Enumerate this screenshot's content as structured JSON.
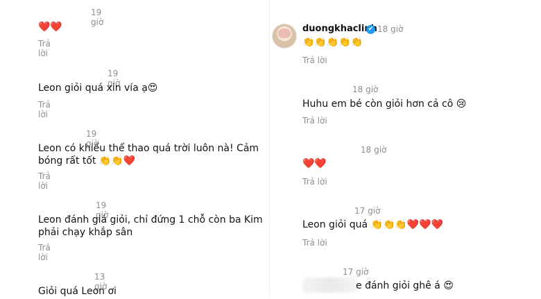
{
  "left_comments": [
    {
      "time": "19 giờ",
      "text": "❤️❤️",
      "reply": "Trả lời"
    },
    {
      "time": "19 giờ",
      "text": "Leon giỏi quá xin vía ạ😍",
      "reply": "Trả lời"
    },
    {
      "time": "19 giờ",
      "text_line1": "Leon có khiếu thể thao quá trời luôn nà! Cảm",
      "text_line2": "bóng rất tốt 👏👏❤️",
      "reply": "Trả lời"
    },
    {
      "time": "19 giờ",
      "text_line1": "Leon đánh giá giỏi, chỉ đứng 1 chỗ còn ba Kim",
      "text_line2": "phải chạy khắp sân",
      "reply": "Trả lời"
    },
    {
      "time": "13 giờ",
      "text": "Giỏi quá Leon ơi"
    }
  ],
  "right_comments": [
    {
      "username": "duongkhaclinh",
      "verified_icon": "✔",
      "time": "18 giờ",
      "text": "👏👏👏👏👏",
      "reply": "Trả lời"
    },
    {
      "time": "18 giờ",
      "text": "Huhu em bé còn giỏi hơn cả cô 😢",
      "reply": "Trả lời"
    },
    {
      "time": "18 giờ",
      "text": "❤️❤️",
      "reply": "Trả lời"
    },
    {
      "time": "17 giờ",
      "text": "Leon giỏi quá 👏👏👏❤️❤️❤️",
      "reply": "Trả lời"
    },
    {
      "time": "17 giờ",
      "text": "e đánh giỏi ghê á 😍"
    }
  ]
}
